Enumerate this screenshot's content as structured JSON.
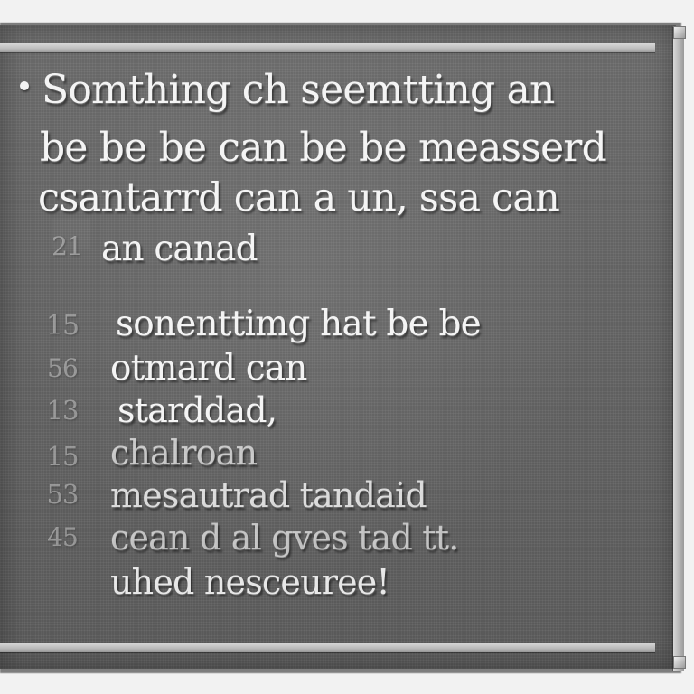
{
  "slide": {
    "lines": [
      "Somthing ch seemtting an",
      "be be be can be be measserd",
      "csantarrd can a un, ssa can",
      "an canad"
    ],
    "line_numbers": [
      "21",
      "15",
      "56",
      "13",
      "15",
      "53",
      "45"
    ],
    "body_lines": [
      "sonenttimg hat be be",
      "otmard can",
      "starddad,",
      "chalroan",
      "mesautrad tandaid",
      "cean d al gves tad tt.",
      "uhed nesceuree!"
    ]
  }
}
